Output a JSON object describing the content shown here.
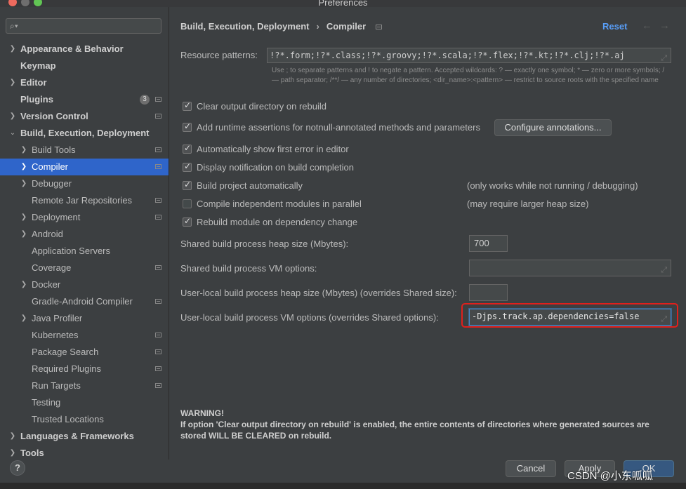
{
  "window": {
    "title": "Preferences"
  },
  "search": {
    "placeholder": ""
  },
  "sidebar": {
    "items": [
      {
        "label": "Appearance & Behavior"
      },
      {
        "label": "Keymap"
      },
      {
        "label": "Editor"
      },
      {
        "label": "Plugins",
        "badge": "3"
      },
      {
        "label": "Version Control"
      },
      {
        "label": "Build, Execution, Deployment"
      },
      {
        "label": "Build Tools"
      },
      {
        "label": "Compiler"
      },
      {
        "label": "Debugger"
      },
      {
        "label": "Remote Jar Repositories"
      },
      {
        "label": "Deployment"
      },
      {
        "label": "Android"
      },
      {
        "label": "Application Servers"
      },
      {
        "label": "Coverage"
      },
      {
        "label": "Docker"
      },
      {
        "label": "Gradle-Android Compiler"
      },
      {
        "label": "Java Profiler"
      },
      {
        "label": "Kubernetes"
      },
      {
        "label": "Package Search"
      },
      {
        "label": "Required Plugins"
      },
      {
        "label": "Run Targets"
      },
      {
        "label": "Testing"
      },
      {
        "label": "Trusted Locations"
      },
      {
        "label": "Languages & Frameworks"
      },
      {
        "label": "Tools"
      }
    ]
  },
  "breadcrumb": {
    "parent": "Build, Execution, Deployment",
    "current": "Compiler"
  },
  "header": {
    "reset_label": "Reset"
  },
  "resource_patterns": {
    "label": "Resource patterns:",
    "value": "!?*.form;!?*.class;!?*.groovy;!?*.scala;!?*.flex;!?*.kt;!?*.clj;!?*.aj",
    "hint": "Use ; to separate patterns and ! to negate a pattern. Accepted wildcards: ? — exactly one symbol; * — zero or more symbols; / — path separator; /**/ — any number of directories; <dir_name>:<pattern> — restrict to source roots with the specified name"
  },
  "options": [
    {
      "label": "Clear output directory on rebuild",
      "checked": true,
      "note": ""
    },
    {
      "label": "Add runtime assertions for notnull-annotated methods and parameters",
      "checked": true,
      "note": ""
    },
    {
      "label": "Automatically show first error in editor",
      "checked": true,
      "note": ""
    },
    {
      "label": "Display notification on build completion",
      "checked": true,
      "note": ""
    },
    {
      "label": "Build project automatically",
      "checked": true,
      "note": "(only works while not running / debugging)"
    },
    {
      "label": "Compile independent modules in parallel",
      "checked": false,
      "note": "(may require larger heap size)"
    },
    {
      "label": "Rebuild module on dependency change",
      "checked": true,
      "note": ""
    }
  ],
  "configure_annotations_label": "Configure annotations...",
  "heap": {
    "label": "Shared build process heap size (Mbytes):",
    "value": "700"
  },
  "vm_options": {
    "label": "Shared build process VM options:",
    "value": ""
  },
  "user_heap": {
    "label": "User-local build process heap size (Mbytes) (overrides Shared size):",
    "value": ""
  },
  "user_vm": {
    "label": "User-local build process VM options (overrides Shared options):",
    "value": "-Djps.track.ap.dependencies=false"
  },
  "warning": {
    "title": "WARNING!",
    "text": "If option 'Clear output directory on rebuild' is enabled, the entire contents of directories where generated sources are stored WILL BE CLEARED on rebuild."
  },
  "footer": {
    "help_label": "?",
    "cancel_label": "Cancel",
    "apply_label": "Apply",
    "ok_label": "OK"
  },
  "watermark": "CSDN @小东呱呱",
  "colors": {
    "accent": "#589df6",
    "selection": "#2f65ca",
    "highlight_box": "#e0201c",
    "background": "#3c3f41"
  }
}
